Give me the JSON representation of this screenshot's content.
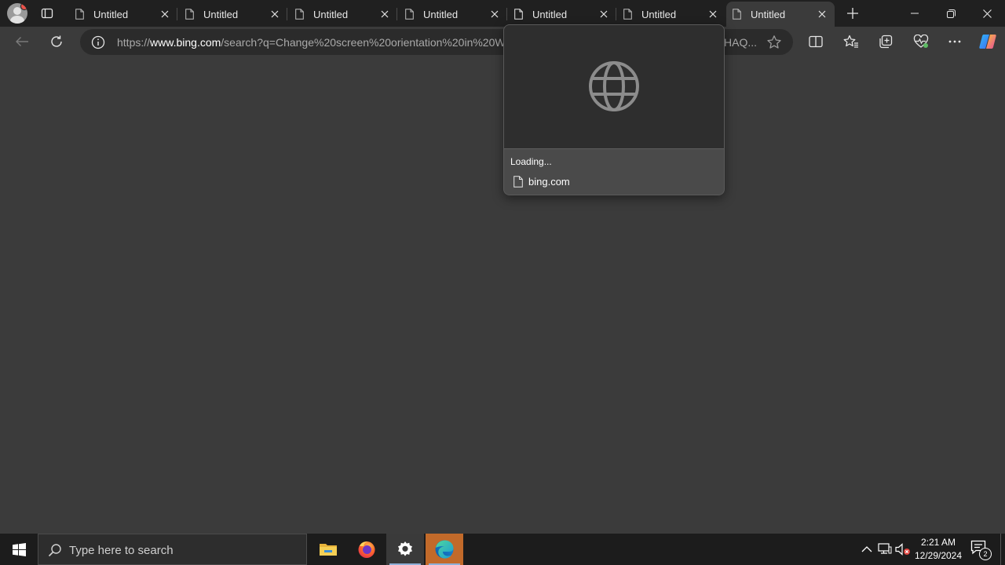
{
  "browser": {
    "tabs": [
      {
        "label": "Untitled"
      },
      {
        "label": "Untitled"
      },
      {
        "label": "Untitled"
      },
      {
        "label": "Untitled"
      },
      {
        "label": "Untitled"
      },
      {
        "label": "Untitled"
      },
      {
        "label": "Untitled"
      }
    ],
    "active_tab_index": 6,
    "address_bar": {
      "url_scheme": "https://",
      "url_host": "www.bing.com",
      "url_path": "/search?q=Change%20screen%20orientation%20in%20W",
      "url_tail": "HAQ..."
    }
  },
  "hover_card": {
    "title": "Loading...",
    "site": "bing.com"
  },
  "taskbar": {
    "search_placeholder": "Type here to search",
    "time": "2:21 AM",
    "date": "12/29/2024",
    "notification_count": "2",
    "pinned_apps": [
      "file-explorer",
      "firefox",
      "settings",
      "edge"
    ]
  },
  "colors": {
    "page_background": "#3b3b3b",
    "tabstrip": "#202020",
    "taskbar": "#1c1c1c",
    "edge_highlight": "#c26a2a"
  }
}
